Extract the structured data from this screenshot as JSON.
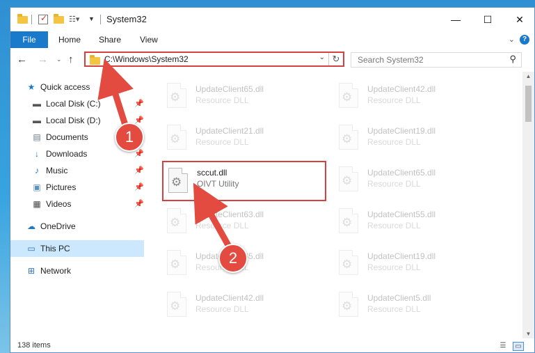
{
  "window": {
    "title": "System32",
    "controls": {
      "minimize": "—",
      "maximize": "☐",
      "close": "✕"
    }
  },
  "ribbon": {
    "tabs": [
      "File",
      "Home",
      "Share",
      "View"
    ],
    "collapse_icon": "chevron-down-icon",
    "help_icon": "?"
  },
  "address": {
    "path": "C:\\Windows\\System32",
    "search_placeholder": "Search System32"
  },
  "nav_pane": {
    "items": [
      {
        "label": "Quick access",
        "icon": "star-icon",
        "pinned": false,
        "selected": false
      },
      {
        "label": "Local Disk (C:)",
        "icon": "drive-icon",
        "pinned": true,
        "selected": false
      },
      {
        "label": "Local Disk (D:)",
        "icon": "drive-icon",
        "pinned": true,
        "selected": false
      },
      {
        "label": "Documents",
        "icon": "documents-icon",
        "pinned": true,
        "selected": false
      },
      {
        "label": "Downloads",
        "icon": "download-icon",
        "pinned": true,
        "selected": false
      },
      {
        "label": "Music",
        "icon": "music-icon",
        "pinned": true,
        "selected": false
      },
      {
        "label": "Pictures",
        "icon": "pictures-icon",
        "pinned": true,
        "selected": false
      },
      {
        "label": "Videos",
        "icon": "videos-icon",
        "pinned": true,
        "selected": false
      },
      {
        "label": "OneDrive",
        "icon": "cloud-icon",
        "pinned": false,
        "selected": false
      },
      {
        "label": "This PC",
        "icon": "computer-icon",
        "pinned": false,
        "selected": true
      },
      {
        "label": "Network",
        "icon": "network-icon",
        "pinned": false,
        "selected": false
      }
    ]
  },
  "files": {
    "left_column": [
      {
        "name": "UpdateClient65.dll",
        "type": "Resource DLL",
        "highlighted": false
      },
      {
        "name": "UpdateClient21.dll",
        "type": "Resource DLL",
        "highlighted": false
      },
      {
        "name": "sccut.dll",
        "type": "OIVT Utility",
        "highlighted": true
      },
      {
        "name": "UpdateClient63.dll",
        "type": "Resource DLL",
        "highlighted": false
      },
      {
        "name": "UpdateClient65.dll",
        "type": "Resource DLL",
        "highlighted": false
      },
      {
        "name": "UpdateClient42.dll",
        "type": "Resource DLL",
        "highlighted": false
      }
    ],
    "right_column": [
      {
        "name": "UpdateClient42.dll",
        "type": "Resource DLL"
      },
      {
        "name": "UpdateClient19.dll",
        "type": "Resource DLL"
      },
      {
        "name": "UpdateClient65.dll",
        "type": "Resource DLL"
      },
      {
        "name": "UpdateClient55.dll",
        "type": "Resource DLL"
      },
      {
        "name": "UpdateClient19.dll",
        "type": "Resource DLL"
      },
      {
        "name": "UpdateClient5.dll",
        "type": "Resource DLL"
      }
    ]
  },
  "status": {
    "item_count": "138 items"
  },
  "annotations": {
    "step1": "1",
    "step2": "2"
  },
  "colors": {
    "accent": "#1979ca",
    "highlight": "#d64040",
    "callout": "#e34a40",
    "selected": "#cce8ff"
  }
}
